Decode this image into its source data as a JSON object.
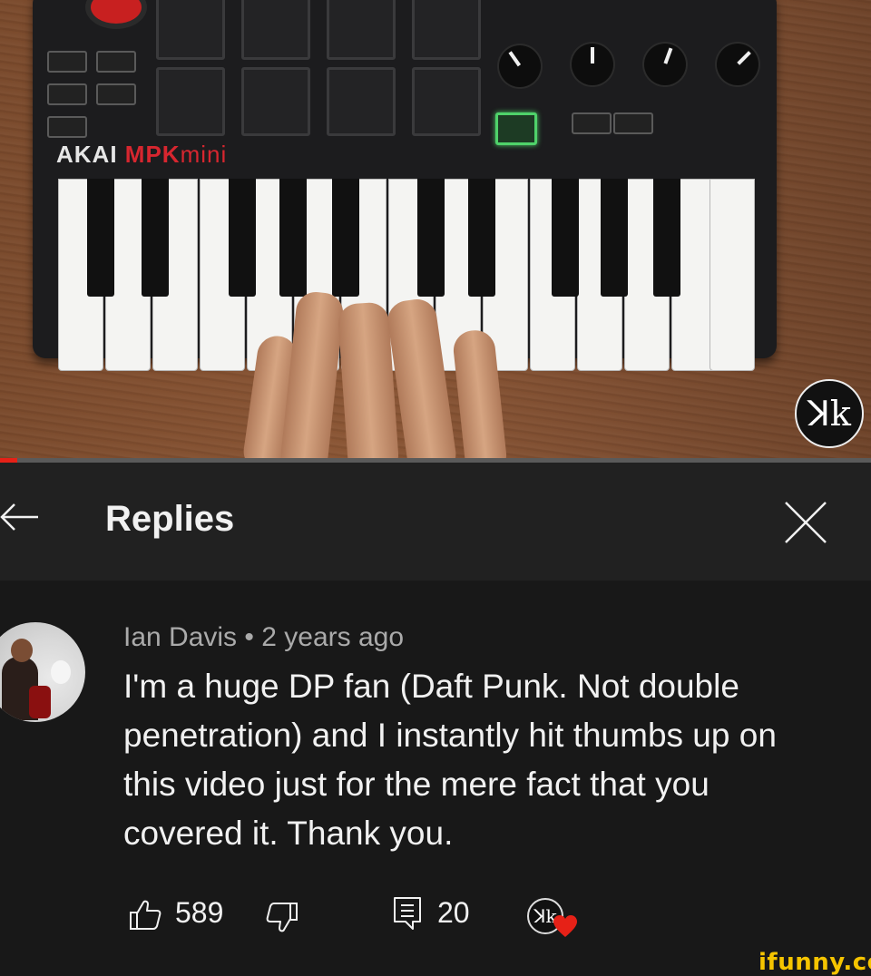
{
  "video": {
    "brand_akai": "AKAI",
    "brand_mpk": "MPK",
    "brand_mini": "mini",
    "channel_logo": "ꓘk",
    "progress_percent": 2,
    "progress_color": "#e62117"
  },
  "header": {
    "title": "Replies",
    "back_icon": "arrow-left-icon",
    "close_icon": "close-icon"
  },
  "comment": {
    "author": "Ian Davis",
    "separator": "•",
    "time": "2 years ago",
    "lines": [
      "I'm a huge DP fan (Daft Punk. Not double",
      "penetration) and I instantly hit thumbs up on",
      "this video just for the mere fact that you",
      "covered it. Thank you."
    ],
    "likes": "589",
    "replies": "20",
    "creator_badge": "ꓘk",
    "heart_color": "#e62117"
  },
  "watermark": "ifunny.co"
}
